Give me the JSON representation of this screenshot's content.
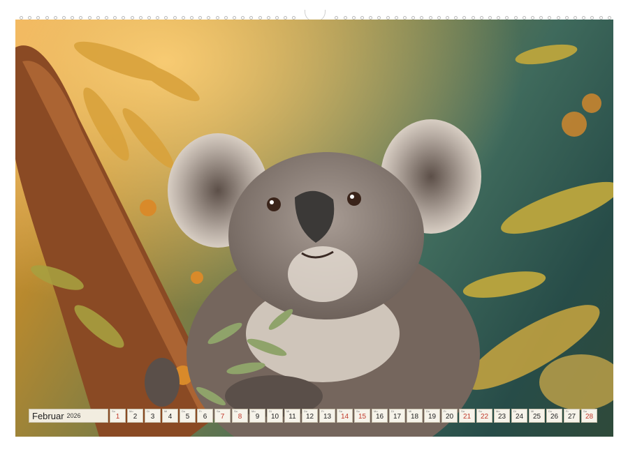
{
  "calendar": {
    "month": "Februar",
    "year": "2026",
    "days": [
      {
        "num": "1",
        "wd": "So",
        "weekend": true
      },
      {
        "num": "2",
        "wd": "Mo",
        "weekend": false
      },
      {
        "num": "3",
        "wd": "Di",
        "weekend": false
      },
      {
        "num": "4",
        "wd": "Mi",
        "weekend": false
      },
      {
        "num": "5",
        "wd": "Do",
        "weekend": false
      },
      {
        "num": "6",
        "wd": "Fr",
        "weekend": false
      },
      {
        "num": "7",
        "wd": "Sa",
        "weekend": true
      },
      {
        "num": "8",
        "wd": "So",
        "weekend": true
      },
      {
        "num": "9",
        "wd": "Mo",
        "weekend": false
      },
      {
        "num": "10",
        "wd": "Di",
        "weekend": false
      },
      {
        "num": "11",
        "wd": "Mi",
        "weekend": false
      },
      {
        "num": "12",
        "wd": "Do",
        "weekend": false
      },
      {
        "num": "13",
        "wd": "Fr",
        "weekend": false
      },
      {
        "num": "14",
        "wd": "Sa",
        "weekend": true
      },
      {
        "num": "15",
        "wd": "So",
        "weekend": true
      },
      {
        "num": "16",
        "wd": "Mo",
        "weekend": false
      },
      {
        "num": "17",
        "wd": "Di",
        "weekend": false
      },
      {
        "num": "18",
        "wd": "Mi",
        "weekend": false
      },
      {
        "num": "19",
        "wd": "Do",
        "weekend": false
      },
      {
        "num": "20",
        "wd": "Fr",
        "weekend": false
      },
      {
        "num": "21",
        "wd": "Sa",
        "weekend": true
      },
      {
        "num": "22",
        "wd": "So",
        "weekend": true
      },
      {
        "num": "23",
        "wd": "Mo",
        "weekend": false
      },
      {
        "num": "24",
        "wd": "Di",
        "weekend": false
      },
      {
        "num": "25",
        "wd": "Mi",
        "weekend": false
      },
      {
        "num": "26",
        "wd": "Do",
        "weekend": false
      },
      {
        "num": "27",
        "wd": "Fr",
        "weekend": false
      },
      {
        "num": "28",
        "wd": "Sa",
        "weekend": true
      }
    ]
  },
  "photo": {
    "subject": "koala-icon",
    "colors": {
      "fur": "#8a7f78",
      "background_dark": "#274c48",
      "light": "#e8a24a",
      "leaf": "#c9a640"
    }
  }
}
